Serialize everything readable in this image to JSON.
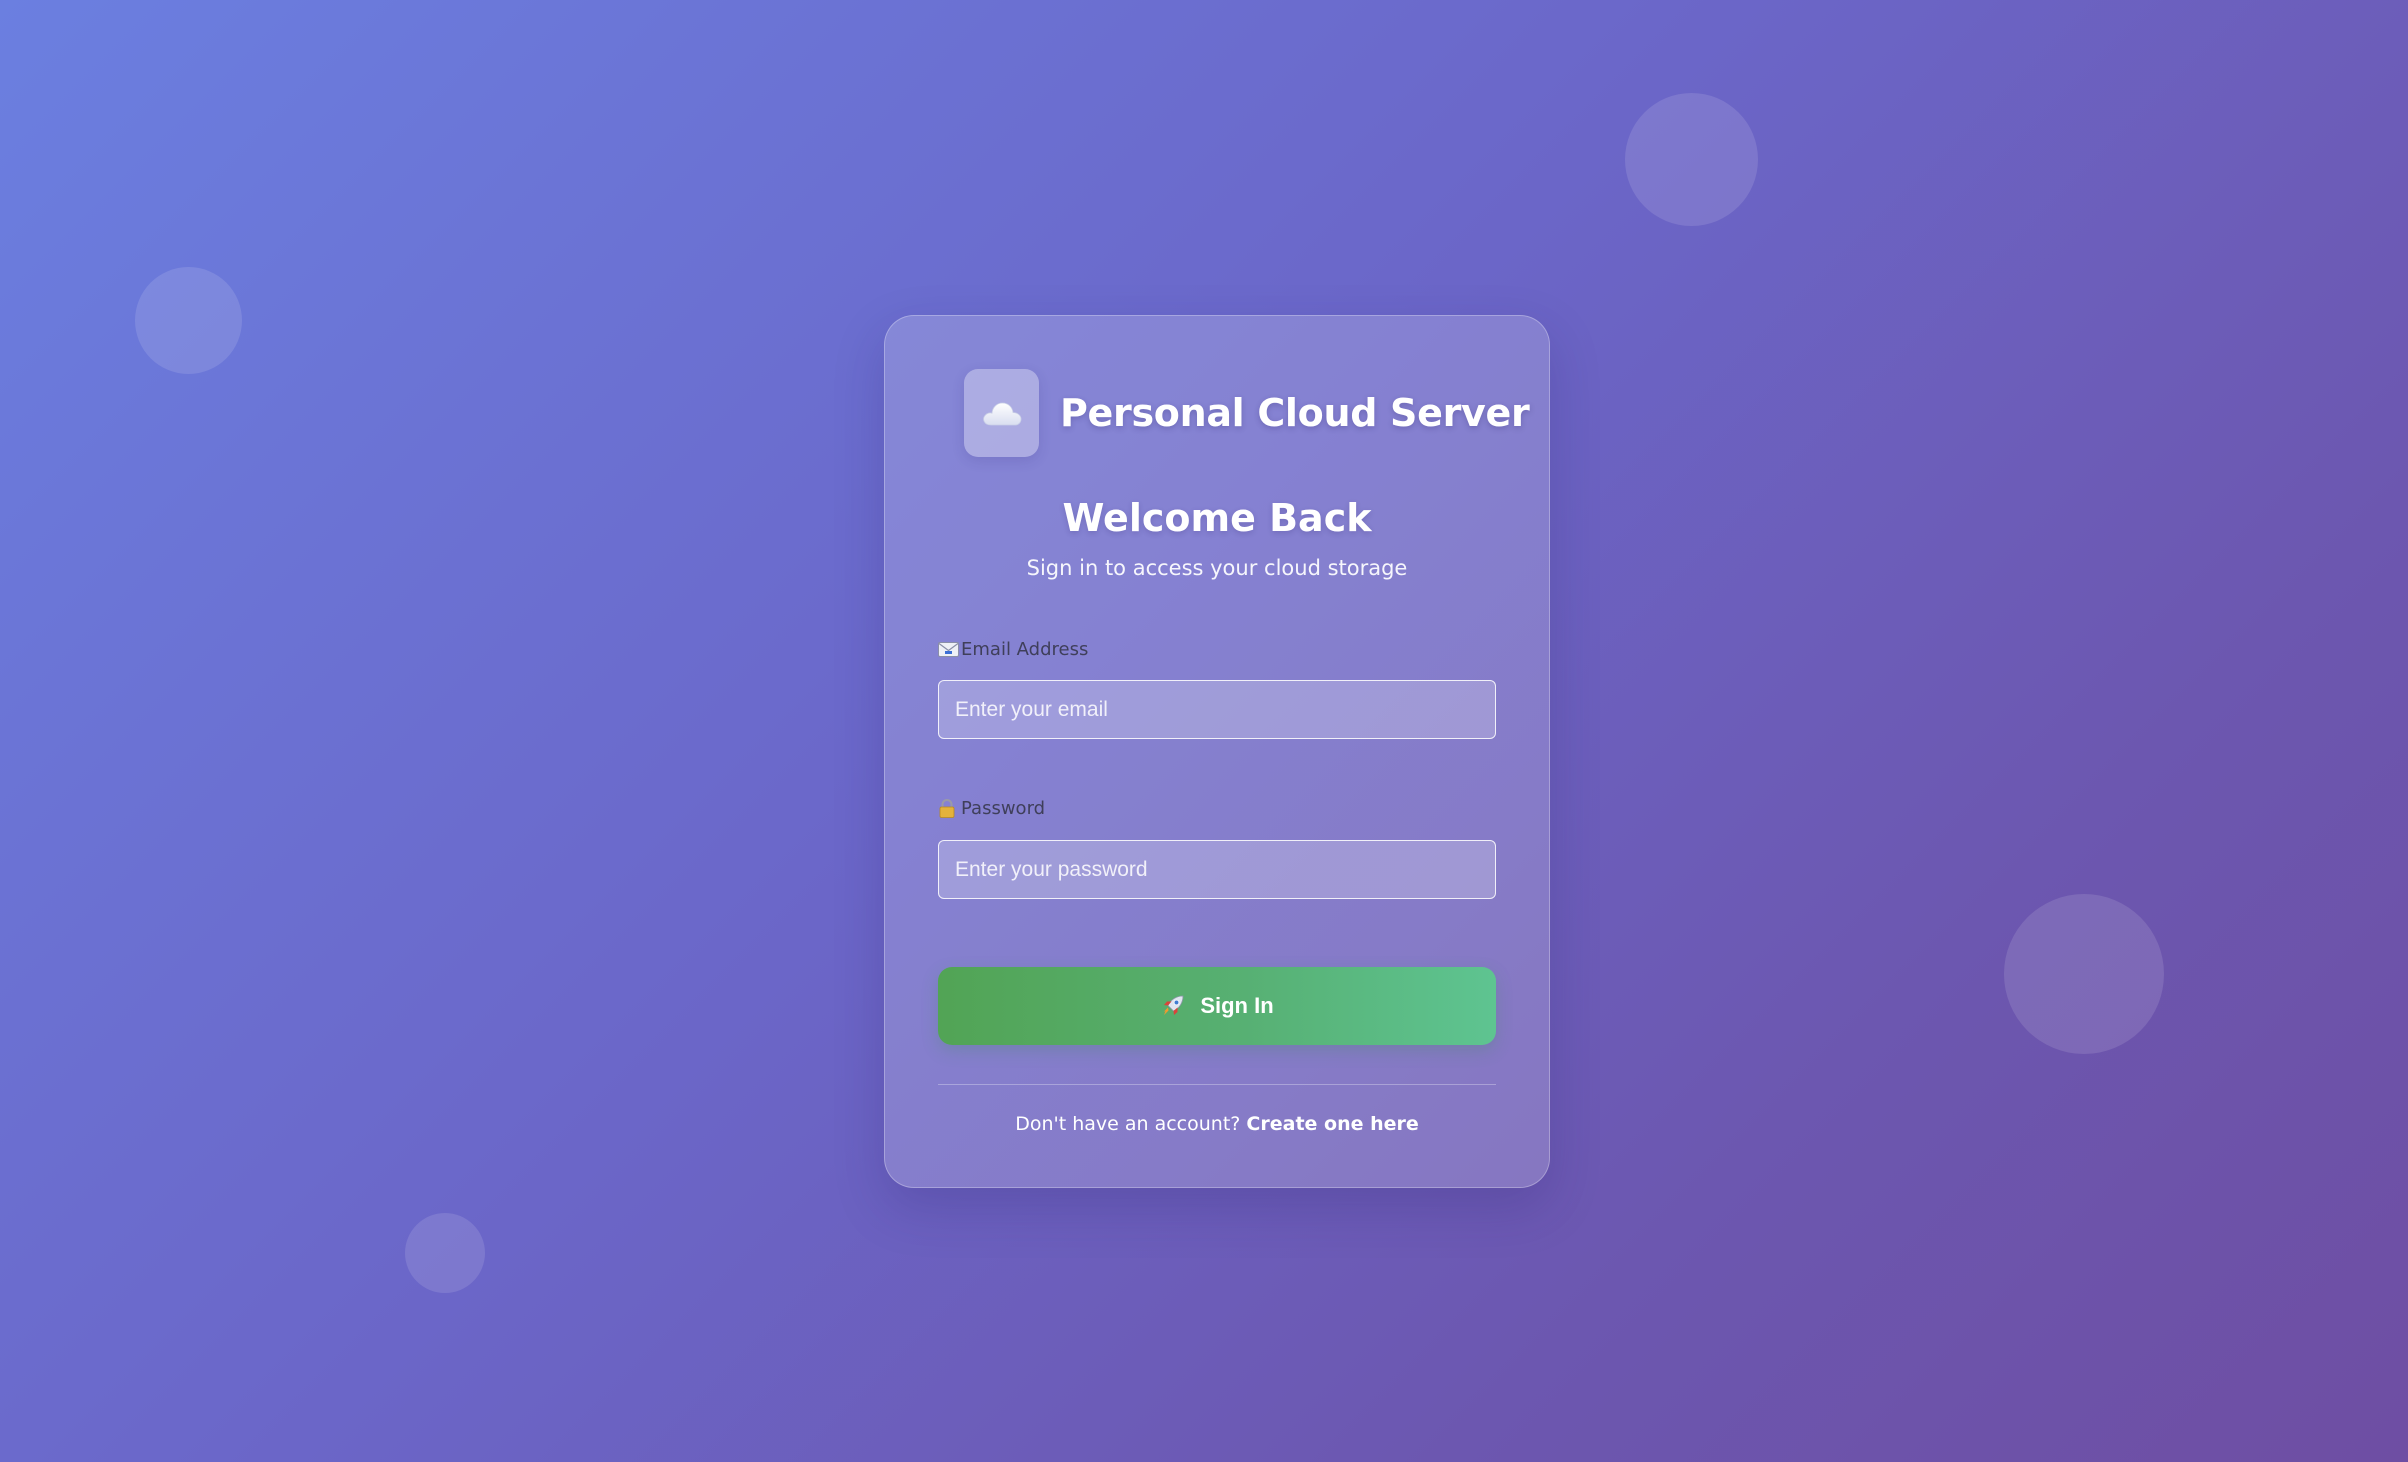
{
  "brand": {
    "name": "Personal Cloud Server",
    "logo_icon": "cloud-icon"
  },
  "heading": {
    "title": "Welcome Back",
    "subtitle": "Sign in to access your cloud storage"
  },
  "form": {
    "email": {
      "icon": "email-icon",
      "label": "Email Address",
      "placeholder": "Enter your email",
      "value": ""
    },
    "password": {
      "icon": "lock-icon",
      "label": "Password",
      "placeholder": "Enter your password",
      "value": ""
    },
    "submit": {
      "icon": "rocket-icon",
      "label": "Sign In"
    }
  },
  "footer": {
    "prompt": "Don't have an account?",
    "link_label": "Create one here"
  },
  "colors": {
    "background_start": "#6b7fe0",
    "background_end": "#6e4ea3",
    "button_start": "#52a455",
    "button_end": "#5ec491"
  }
}
